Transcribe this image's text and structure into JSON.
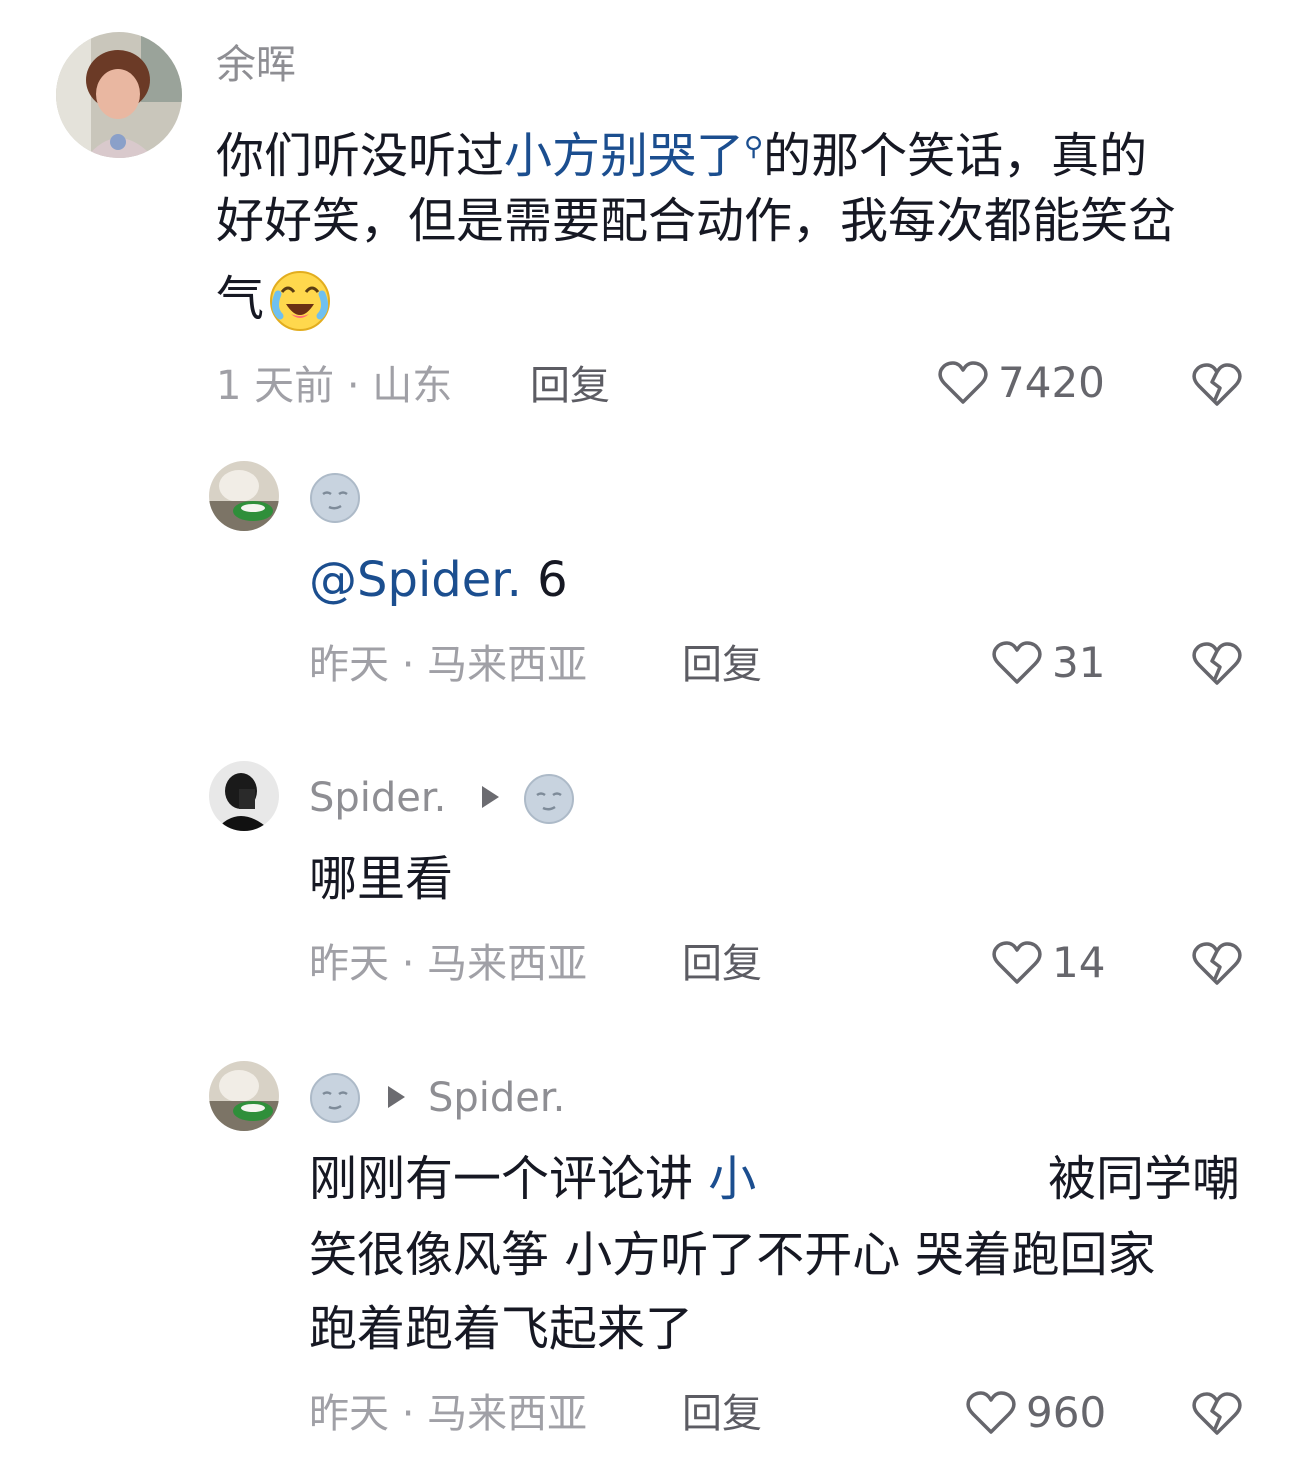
{
  "comments": [
    {
      "username": "余晖",
      "text_line1_pre": "你们听没听过",
      "text_line1_link": "小方别哭了",
      "text_line1_post": "的那个笑话，真的",
      "text_line2": "好好笑，但是需要配合动作，我每次都能笑岔",
      "text_line3": "气",
      "time_location": "1 天前 · 山东",
      "reply_label": "回复",
      "likes": "7420"
    },
    {
      "mention": "@Spider.",
      "text": " 6",
      "time_location": "昨天 · 马来西亚",
      "reply_label": "回复",
      "likes": "31"
    },
    {
      "username": "Spider.",
      "text": "哪里看",
      "time_location": "昨天 · 马来西亚",
      "reply_label": "回复",
      "likes": "14"
    },
    {
      "reply_to": "Spider.",
      "text_line1_pre": "刚刚有一个评论讲 ",
      "text_line1_link": "小",
      "text_line1_post": "被同学嘲",
      "text_line2": "笑很像风筝 小方听了不开心 哭着跑回家",
      "text_line3": "跑着跑着飞起来了",
      "time_location": "昨天 · 马来西亚",
      "reply_label": "回复",
      "likes": "960"
    }
  ],
  "icons": {
    "like": "heart-outline-icon",
    "dislike": "broken-heart-icon",
    "moon": "moon-face-emoji",
    "cry_laugh": "crying-laughing-emoji",
    "reply_arrow": "play-arrow-icon",
    "search": "search-icon"
  },
  "colors": {
    "link": "#1b4e8f",
    "meta": "#a0a0a6",
    "text": "#161823"
  }
}
